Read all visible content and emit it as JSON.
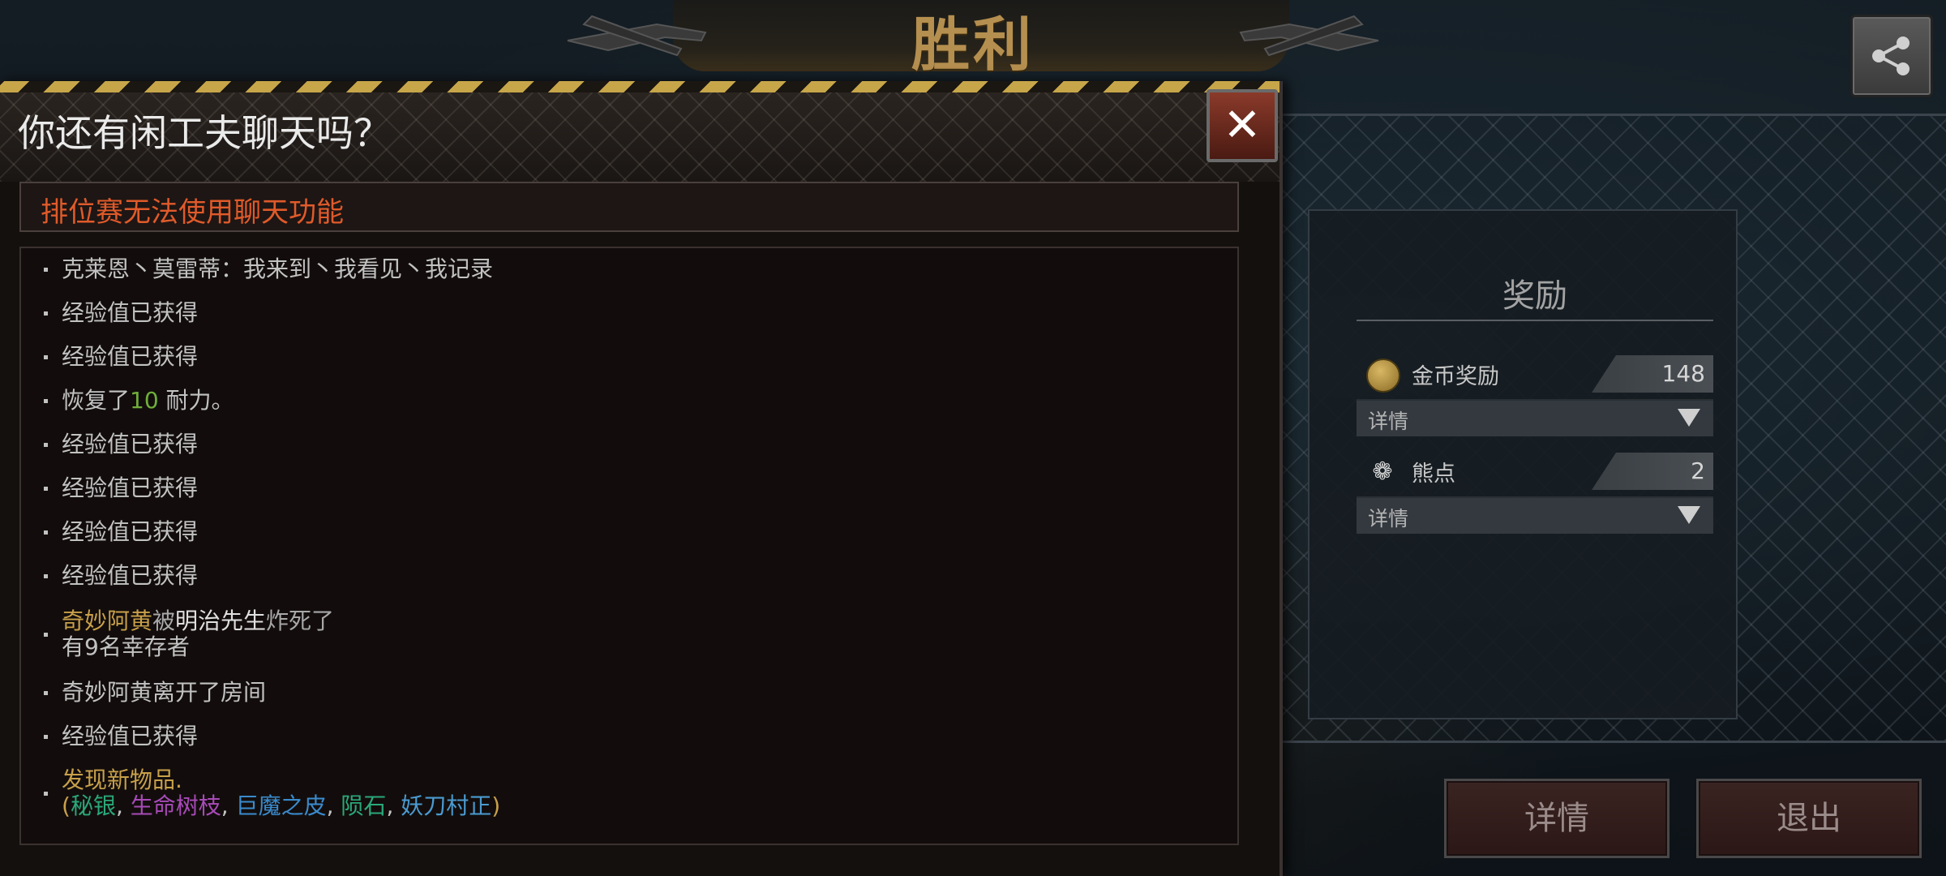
{
  "header": {
    "victory_label": "胜利"
  },
  "chat": {
    "title": "你还有闲工夫聊天吗？",
    "close_label": "✕",
    "warning": "排位赛无法使用聊天功能",
    "lines": [
      {
        "text": "克莱恩丶莫雷蒂：我来到丶我看见丶我记录"
      },
      {
        "text": "经验值已获得"
      },
      {
        "text": "经验值已获得"
      },
      {
        "pre": "恢复了",
        "num": "10",
        "post": " 耐力。"
      },
      {
        "text": "经验值已获得"
      },
      {
        "text": "经验值已获得"
      },
      {
        "text": "经验值已获得"
      },
      {
        "text": "经验值已获得"
      },
      {
        "a": "奇妙阿黄",
        "b": "被",
        "c": "明治先生",
        "d": "炸死了",
        "line2": "有9名幸存者"
      },
      {
        "text": "奇妙阿黄离开了房间"
      },
      {
        "text": "经验值已获得"
      },
      {
        "found": "发现新物品.",
        "open": "(",
        "i1": "秘银",
        "i2": "生命树枝",
        "i3": "巨魔之皮",
        "i4": "陨石",
        "i5": "妖刀村正",
        "sep": ", ",
        "close": ")"
      }
    ]
  },
  "reward": {
    "title": "奖励",
    "gold_label": "金币奖励",
    "gold_value": "148",
    "bear_label": "熊点",
    "bear_value": "2",
    "detail_label": "详情"
  },
  "buttons": {
    "details": "详情",
    "exit": "退出"
  },
  "icons": [
    "share-icon",
    "close-icon",
    "coin-icon",
    "bear-paw-icon",
    "dropdown-arrow-icon"
  ]
}
